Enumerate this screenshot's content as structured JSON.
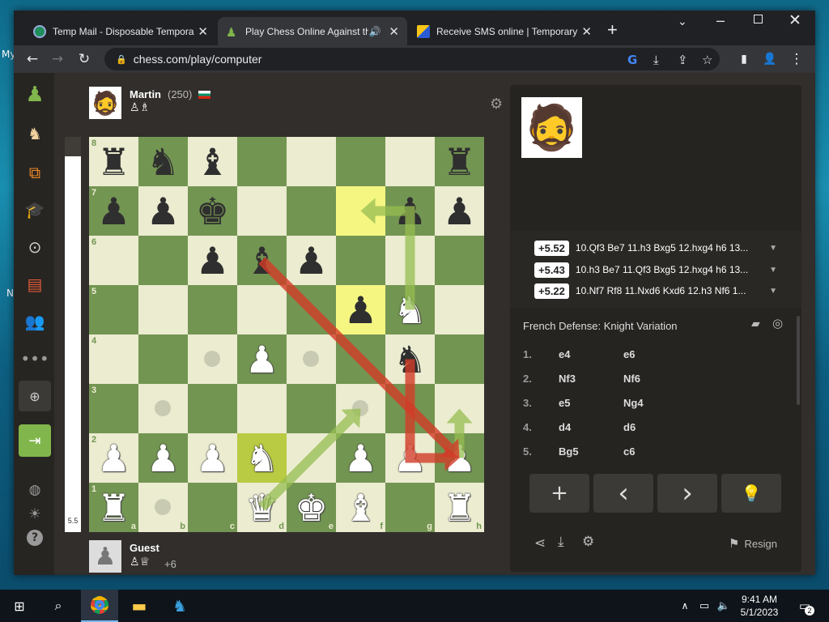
{
  "desktop": {
    "icon_label1": "My",
    "icon_label2": "N"
  },
  "browser": {
    "tabs": [
      {
        "title": "Temp Mail - Disposable Tempora",
        "close": "✕"
      },
      {
        "title": "Play Chess Online Against th",
        "close": "✕"
      },
      {
        "title": "Receive SMS online | Temporary",
        "close": "✕"
      }
    ],
    "new_tab": "+",
    "url": "chess.com/play/computer"
  },
  "opponent": {
    "name": "Martin",
    "rating": "(250)",
    "flag": "bulgaria"
  },
  "player": {
    "name": "Guest",
    "material": "+6"
  },
  "eval": {
    "value": "5.5"
  },
  "board": {
    "files": [
      "a",
      "b",
      "c",
      "d",
      "e",
      "f",
      "g",
      "h"
    ],
    "ranks": [
      "8",
      "7",
      "6",
      "5",
      "4",
      "3",
      "2",
      "1"
    ],
    "pieces": [
      {
        "sq": "a8",
        "g": "♜",
        "c": "b"
      },
      {
        "sq": "b8",
        "g": "♞",
        "c": "b"
      },
      {
        "sq": "c8",
        "g": "♝",
        "c": "b"
      },
      {
        "sq": "h8",
        "g": "♜",
        "c": "b"
      },
      {
        "sq": "a7",
        "g": "♟",
        "c": "b"
      },
      {
        "sq": "b7",
        "g": "♟",
        "c": "b"
      },
      {
        "sq": "c7",
        "g": "♚",
        "c": "b"
      },
      {
        "sq": "g7",
        "g": "♟",
        "c": "b"
      },
      {
        "sq": "h7",
        "g": "♟",
        "c": "b"
      },
      {
        "sq": "c6",
        "g": "♟",
        "c": "b"
      },
      {
        "sq": "d6",
        "g": "♝",
        "c": "b"
      },
      {
        "sq": "e6",
        "g": "♟",
        "c": "b"
      },
      {
        "sq": "f5",
        "g": "♟",
        "c": "b"
      },
      {
        "sq": "g5",
        "g": "♞",
        "c": "w"
      },
      {
        "sq": "d4",
        "g": "♟",
        "c": "w"
      },
      {
        "sq": "g4",
        "g": "♞",
        "c": "b"
      },
      {
        "sq": "a2",
        "g": "♟",
        "c": "w"
      },
      {
        "sq": "b2",
        "g": "♟",
        "c": "w"
      },
      {
        "sq": "c2",
        "g": "♟",
        "c": "w"
      },
      {
        "sq": "d2",
        "g": "♞",
        "c": "w"
      },
      {
        "sq": "f2",
        "g": "♟",
        "c": "w"
      },
      {
        "sq": "g2",
        "g": "♟",
        "c": "w"
      },
      {
        "sq": "h2",
        "g": "♟",
        "c": "w"
      },
      {
        "sq": "a1",
        "g": "♜",
        "c": "w"
      },
      {
        "sq": "d1",
        "g": "♛",
        "c": "w"
      },
      {
        "sq": "e1",
        "g": "♚",
        "c": "w"
      },
      {
        "sq": "f1",
        "g": "♝",
        "c": "w"
      },
      {
        "sq": "h1",
        "g": "♜",
        "c": "w"
      }
    ],
    "highlights": [
      "f7",
      "f5",
      "d2"
    ],
    "dots": [
      "c4",
      "e4",
      "b3",
      "f3",
      "b1"
    ]
  },
  "engine_lines": [
    {
      "score": "+5.52",
      "line": "10.Qf3 Be7 11.h3 Bxg5 12.hxg4 h6 13..."
    },
    {
      "score": "+5.43",
      "line": "10.h3 Be7 11.Qf3 Bxg5 12.hxg4 h6 13..."
    },
    {
      "score": "+5.22",
      "line": "10.Nf7 Rf8 11.Nxd6 Kxd6 12.h3 Nf6 1..."
    }
  ],
  "opening": "French Defense: Knight Variation",
  "moves": [
    {
      "n": "1.",
      "w": "e4",
      "b": "e6"
    },
    {
      "n": "2.",
      "w": "Nf3",
      "b": "Nf6"
    },
    {
      "n": "3.",
      "w": "e5",
      "b": "Ng4"
    },
    {
      "n": "4.",
      "w": "d4",
      "b": "d6"
    },
    {
      "n": "5.",
      "w": "Bg5",
      "b": "c6"
    }
  ],
  "controls": {
    "add": "+",
    "prev": "‹",
    "next": "›",
    "hint": "💡"
  },
  "footer": {
    "resign": "Resign"
  },
  "clock": {
    "time": "9:41 AM",
    "date": "5/1/2023",
    "notif": "2"
  }
}
